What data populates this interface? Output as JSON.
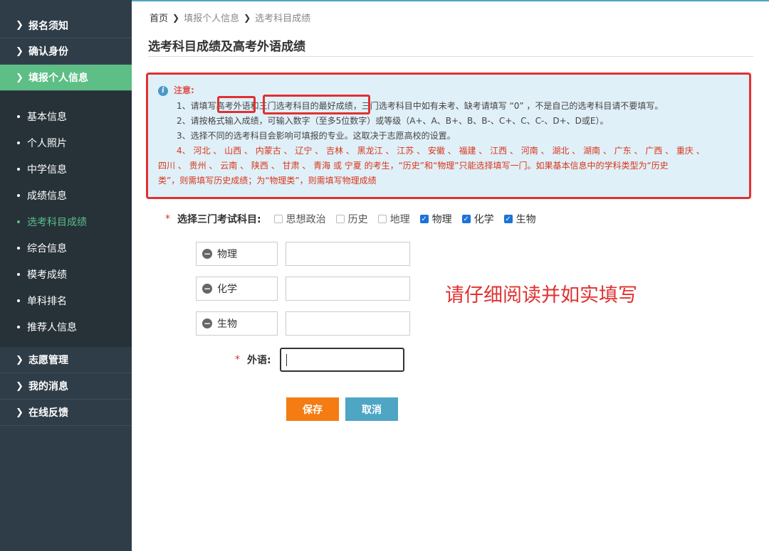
{
  "sidebar": {
    "top_items": [
      {
        "label": "报名须知"
      },
      {
        "label": "确认身份"
      },
      {
        "label": "填报个人信息"
      }
    ],
    "sub_items": [
      {
        "label": "基本信息"
      },
      {
        "label": "个人照片"
      },
      {
        "label": "中学信息"
      },
      {
        "label": "成绩信息"
      },
      {
        "label": "选考科目成绩"
      },
      {
        "label": "综合信息"
      },
      {
        "label": "模考成绩"
      },
      {
        "label": "单科排名"
      },
      {
        "label": "推荐人信息"
      }
    ],
    "bottom_items": [
      {
        "label": "志愿管理"
      },
      {
        "label": "我的消息"
      },
      {
        "label": "在线反馈"
      }
    ],
    "active_top": "填报个人信息",
    "active_sub": "选考科目成绩"
  },
  "breadcrumb": {
    "home": "首页",
    "level1": "填报个人信息",
    "level2": "选考科目成绩"
  },
  "page_title": "选考科目成绩及高考外语成绩",
  "notice": {
    "heading": "注意:",
    "line1_a": "1、请填写",
    "line1_b": "高考外语",
    "line1_c": "和",
    "line1_d": "三门选考科目的最好成绩",
    "line1_e": "，三门选考科目中如有未考、缺考请填写 “0” ，不是自己的选考科目请不要填写。",
    "line2": "2、请按格式输入成绩，可输入数字（至多5位数字）或等级（A+、A、B+、B、B-、C+、C、C-、D+、D或E）。",
    "line3": "3、选择不同的选考科目会影响可填报的专业。这取决于志愿高校的设置。",
    "line4a": "4、 河北 、 山西 、 内蒙古 、 辽宁 、 吉林 、 黑龙江 、 江苏 、 安徽 、 福建 、 江西 、 河南 、 湖北 、 湖南 、 广东 、 广西 、 重庆 、",
    "line4b": "四川 、 贵州 、 云南 、 陕西 、 甘肃 、 青海 或 宁夏 的考生，“历史”和“物理”只能选择填写一门。如果基本信息中的学科类型为“历史",
    "line4c": "类”，则需填写历史成绩；为“物理类”，则需填写物理成绩"
  },
  "subject_select": {
    "required_mark": "*",
    "label": "选择三门考试科目:",
    "options": [
      {
        "label": "思想政治",
        "checked": false
      },
      {
        "label": "历史",
        "checked": false
      },
      {
        "label": "地理",
        "checked": false
      },
      {
        "label": "物理",
        "checked": true
      },
      {
        "label": "化学",
        "checked": true
      },
      {
        "label": "生物",
        "checked": true
      }
    ]
  },
  "score_rows": [
    {
      "subject": "物理",
      "value": ""
    },
    {
      "subject": "化学",
      "value": ""
    },
    {
      "subject": "生物",
      "value": ""
    }
  ],
  "foreign": {
    "required_mark": "*",
    "label": "外语:",
    "value": ""
  },
  "tip": "请仔细阅读并如实填写",
  "buttons": {
    "save": "保存",
    "cancel": "取消"
  },
  "colors": {
    "sidebar_bg": "#2f3d48",
    "active_green": "#5dbe86",
    "highlight_red": "#e03131",
    "save_orange": "#f57c12",
    "cancel_blue": "#4ea5c4"
  }
}
